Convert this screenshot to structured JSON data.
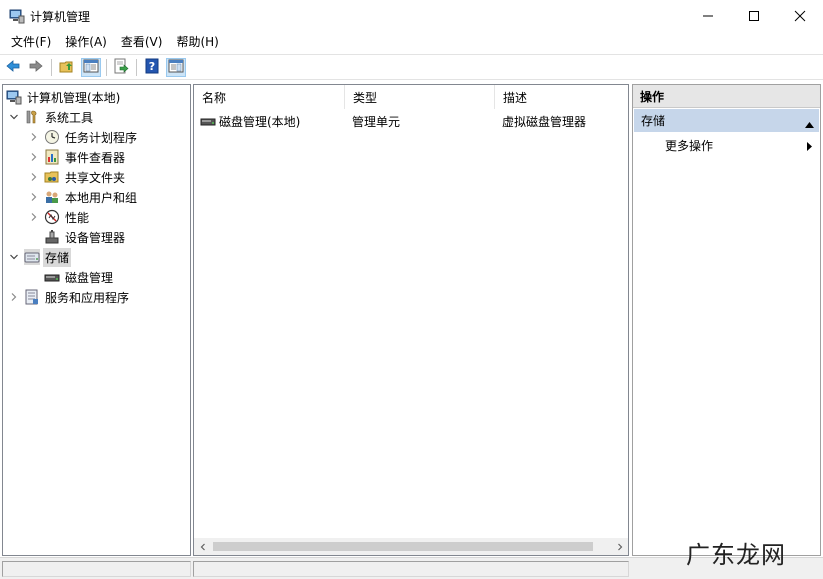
{
  "window": {
    "title": "计算机管理",
    "controls": [
      "minimize",
      "maximize",
      "close"
    ]
  },
  "menu": [
    "文件(F)",
    "操作(A)",
    "查看(V)",
    "帮助(H)"
  ],
  "toolbar": {
    "icons": [
      "back-arrow-icon",
      "forward-arrow-icon",
      "up-folder-icon",
      "show-hide-tree-icon",
      "export-list-icon",
      "help-icon",
      "show-hide-action-pane-icon"
    ]
  },
  "tree": [
    {
      "label": "计算机管理(本地)",
      "icon": "computer-management-icon",
      "level": 0,
      "expander": "none"
    },
    {
      "label": "系统工具",
      "icon": "system-tools-icon",
      "level": 1,
      "expander": "expanded"
    },
    {
      "label": "任务计划程序",
      "icon": "clock-icon",
      "level": 2,
      "expander": "collapsed"
    },
    {
      "label": "事件查看器",
      "icon": "event-viewer-icon",
      "level": 2,
      "expander": "collapsed"
    },
    {
      "label": "共享文件夹",
      "icon": "shared-folder-icon",
      "level": 2,
      "expander": "collapsed"
    },
    {
      "label": "本地用户和组",
      "icon": "users-icon",
      "level": 2,
      "expander": "collapsed"
    },
    {
      "label": "性能",
      "icon": "performance-icon",
      "level": 2,
      "expander": "collapsed"
    },
    {
      "label": "设备管理器",
      "icon": "device-manager-icon",
      "level": 2,
      "expander": "none"
    },
    {
      "label": "存储",
      "icon": "storage-icon",
      "level": 1,
      "expander": "expanded",
      "selected": true
    },
    {
      "label": "磁盘管理",
      "icon": "disk-icon",
      "level": 2,
      "expander": "none"
    },
    {
      "label": "服务和应用程序",
      "icon": "services-icon",
      "level": 1,
      "expander": "collapsed"
    }
  ],
  "list": {
    "columns": [
      "名称",
      "类型",
      "描述"
    ],
    "rows": [
      {
        "name": "磁盘管理(本地)",
        "type": "管理单元",
        "description": "虚拟磁盘管理器"
      }
    ]
  },
  "actions": {
    "header": "操作",
    "section": "存储",
    "item": "更多操作"
  },
  "watermark": "广东龙网",
  "colors": {
    "selection": "#d9d9d9",
    "action_section": "#c6d6ea",
    "toolbar_active": "#cce4f7",
    "accent_blue": "#1f6fc5"
  }
}
